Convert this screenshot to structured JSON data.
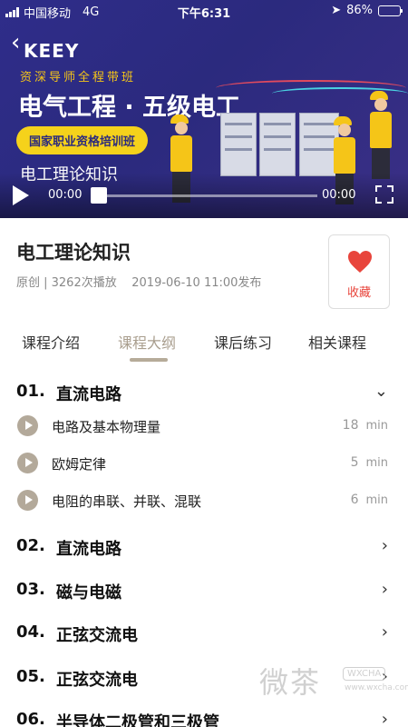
{
  "status_bar": {
    "carrier": "中国移动",
    "network": "4G",
    "time": "下午6:31",
    "battery": "86%",
    "battery_level": 0.86
  },
  "banner": {
    "logo": "KEEY",
    "subtitle": "资深导师全程带班",
    "title": "电气工程 · 五级电工",
    "badge": "国家职业资格培训班",
    "caption": "电工理论知识",
    "colors": {
      "background": "#2f2d8a",
      "accent": "#f5c518"
    }
  },
  "player": {
    "current_time": "00:00",
    "duration": "00:00",
    "progress": 0
  },
  "course": {
    "title": "电工理论知识",
    "meta": "原创 | 3262次播放    2019-06-10 11:00发布",
    "favorite_label": "收藏",
    "favorite_color": "#e8453c"
  },
  "tabs": [
    {
      "label": "课程介绍"
    },
    {
      "label": "课程大纲"
    },
    {
      "label": "课后练习"
    },
    {
      "label": "相关课程"
    }
  ],
  "outline": {
    "chapters": [
      {
        "num": "01.",
        "name": "直流电路",
        "expanded": true,
        "lessons": [
          {
            "name": "电路及基本物理量",
            "minutes": "18",
            "unit": "min"
          },
          {
            "name": "欧姆定律",
            "minutes": "5",
            "unit": "min"
          },
          {
            "name": "电阻的串联、并联、混联",
            "minutes": "6",
            "unit": "min"
          }
        ]
      },
      {
        "num": "02.",
        "name": "直流电路"
      },
      {
        "num": "03.",
        "name": "磁与电磁"
      },
      {
        "num": "04.",
        "name": "正弦交流电"
      },
      {
        "num": "05.",
        "name": "正弦交流电"
      },
      {
        "num": "06.",
        "name": "半导体二极管和三极管"
      }
    ]
  },
  "watermark": {
    "text": "微茶",
    "badge": "WXCHA",
    "url": "www.wxcha.com"
  }
}
